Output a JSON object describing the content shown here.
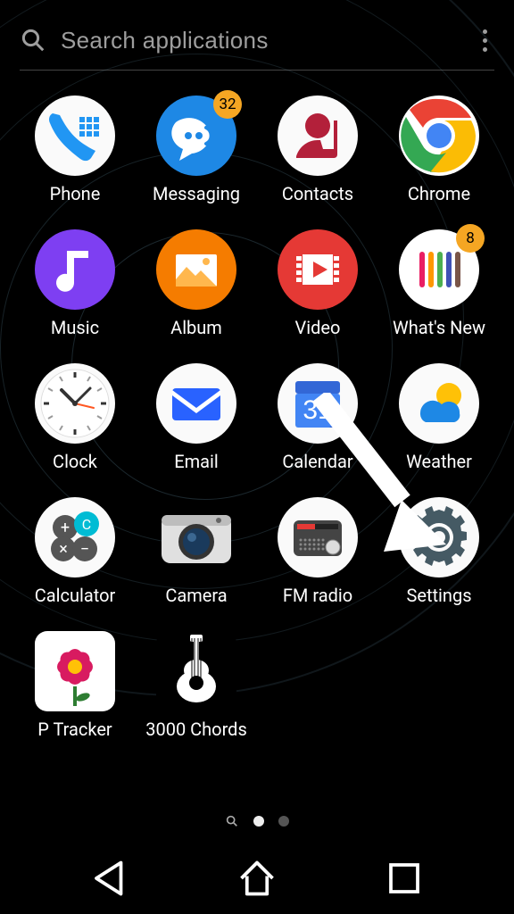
{
  "search": {
    "placeholder": "Search applications"
  },
  "apps": [
    {
      "id": "phone",
      "label": "Phone",
      "badge": null
    },
    {
      "id": "messaging",
      "label": "Messaging",
      "badge": "32"
    },
    {
      "id": "contacts",
      "label": "Contacts",
      "badge": null
    },
    {
      "id": "chrome",
      "label": "Chrome",
      "badge": null
    },
    {
      "id": "music",
      "label": "Music",
      "badge": null
    },
    {
      "id": "album",
      "label": "Album",
      "badge": null
    },
    {
      "id": "video",
      "label": "Video",
      "badge": null
    },
    {
      "id": "whatsnew",
      "label": "What's New",
      "badge": "8"
    },
    {
      "id": "clock",
      "label": "Clock",
      "badge": null
    },
    {
      "id": "email",
      "label": "Email",
      "badge": null
    },
    {
      "id": "calendar",
      "label": "Calendar",
      "badge": null,
      "day": "31"
    },
    {
      "id": "weather",
      "label": "Weather",
      "badge": null
    },
    {
      "id": "calculator",
      "label": "Calculator",
      "badge": null
    },
    {
      "id": "camera",
      "label": "Camera",
      "badge": null
    },
    {
      "id": "fmradio",
      "label": "FM radio",
      "badge": null
    },
    {
      "id": "settings",
      "label": "Settings",
      "badge": null
    },
    {
      "id": "ptracker",
      "label": "P Tracker",
      "badge": null
    },
    {
      "id": "chords",
      "label": "3000 Chords",
      "badge": null
    }
  ],
  "pager": {
    "pages": 2,
    "active": 0
  },
  "annotation": {
    "target_app": "settings"
  },
  "nav": {
    "buttons": [
      "back",
      "home",
      "recent"
    ]
  },
  "colors": {
    "badge_bg": "#f5a623",
    "chrome_red": "#ea4335",
    "chrome_yellow": "#fbbc05",
    "chrome_green": "#34a853",
    "chrome_blue": "#4285f4"
  }
}
